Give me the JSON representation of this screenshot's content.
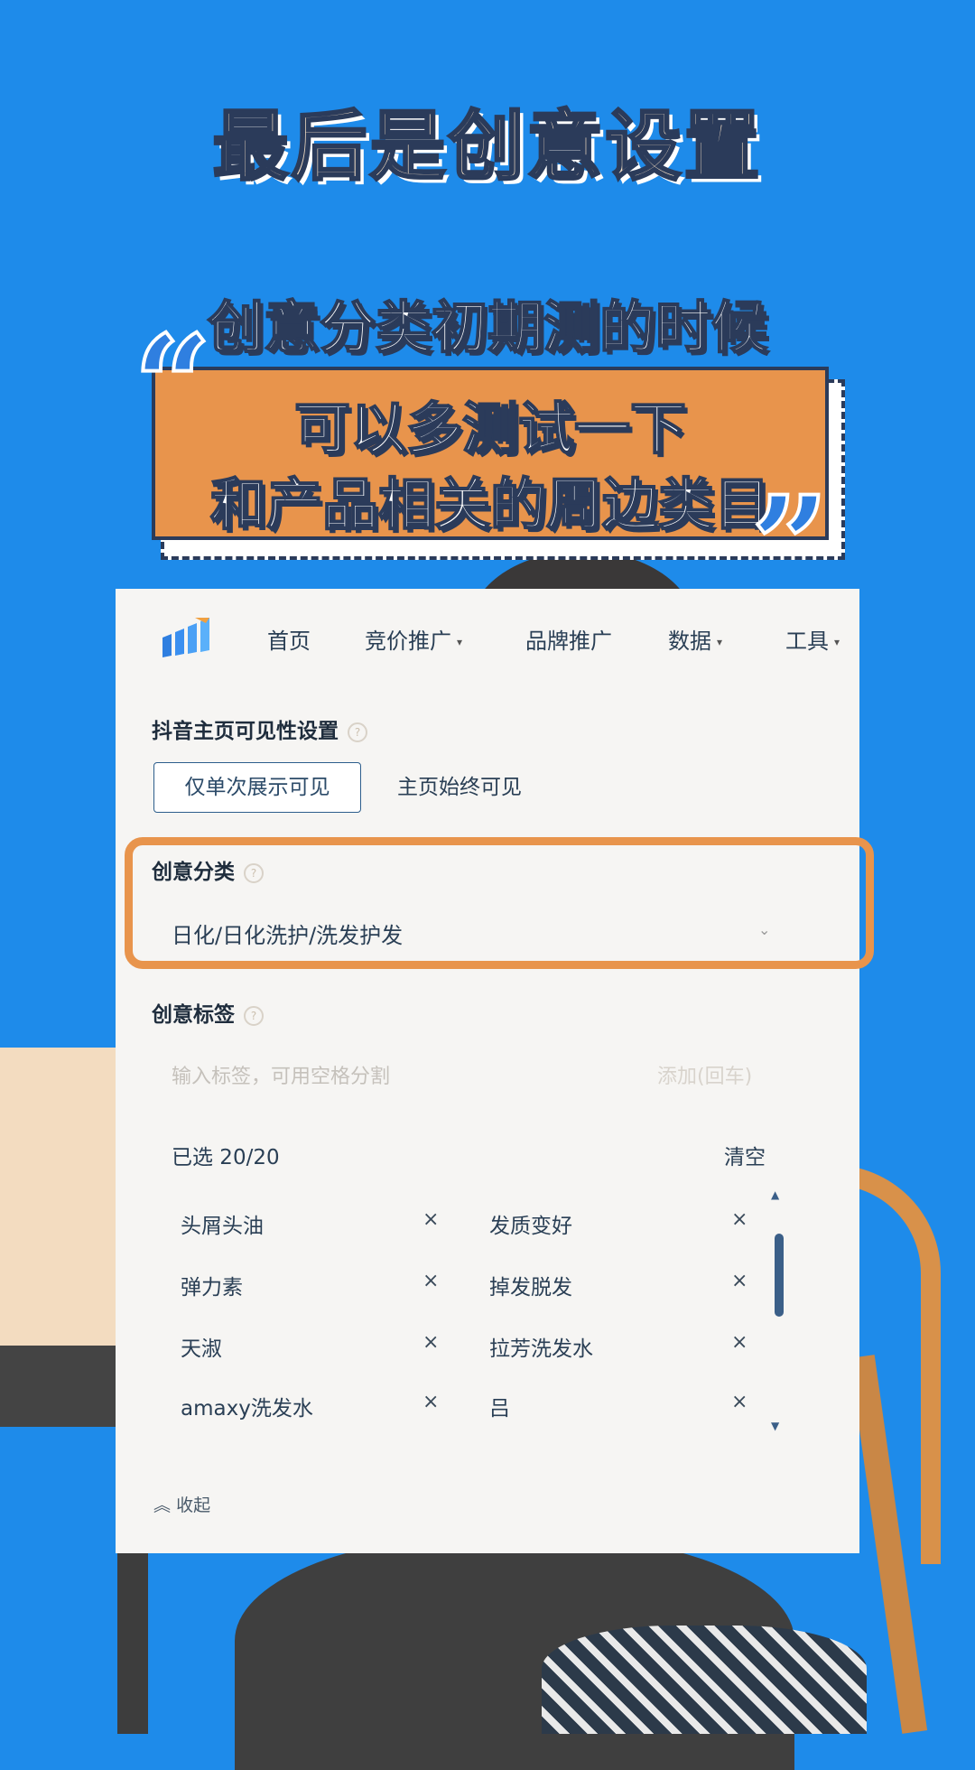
{
  "overlay": {
    "title": "最后是创意设置",
    "subtitle": "创意分类初期测的时候",
    "banner_line1": "可以多测试一下",
    "banner_line2": "和产品相关的周边类目",
    "quote_open": "“",
    "quote_close": "”"
  },
  "nav": {
    "logo_icon": "bar-chart-logo",
    "items": [
      {
        "label": "首页",
        "has_dropdown": false
      },
      {
        "label": "竞价推广",
        "has_dropdown": true
      },
      {
        "label": "品牌推广",
        "has_dropdown": false
      },
      {
        "label": "数据",
        "has_dropdown": true
      },
      {
        "label": "工具",
        "has_dropdown": true
      }
    ],
    "caret": "▾"
  },
  "visibility": {
    "label": "抖音主页可见性设置",
    "options": [
      "仅单次展示可见",
      "主页始终可见"
    ]
  },
  "category": {
    "label": "创意分类",
    "value": "日化/日化洗护/洗发护发"
  },
  "tags": {
    "label": "创意标签",
    "input_placeholder": "输入标签，可用空格分割",
    "add_label": "添加(回车)",
    "selected_text": "已选 20/20",
    "clear_label": "清空",
    "remove_icon": "×",
    "items": [
      "头屑头油",
      "发质变好",
      "弹力素",
      "掉发脱发",
      "天淑",
      "拉芳洗发水",
      "amaxy洗发水",
      "吕"
    ]
  },
  "help_icon": "?",
  "collapse_label": "收起",
  "colors": {
    "background": "#1e8bea",
    "accent_orange": "#e8944c",
    "panel_bg": "#f6f5f3",
    "text_dark": "#2a3f55"
  }
}
